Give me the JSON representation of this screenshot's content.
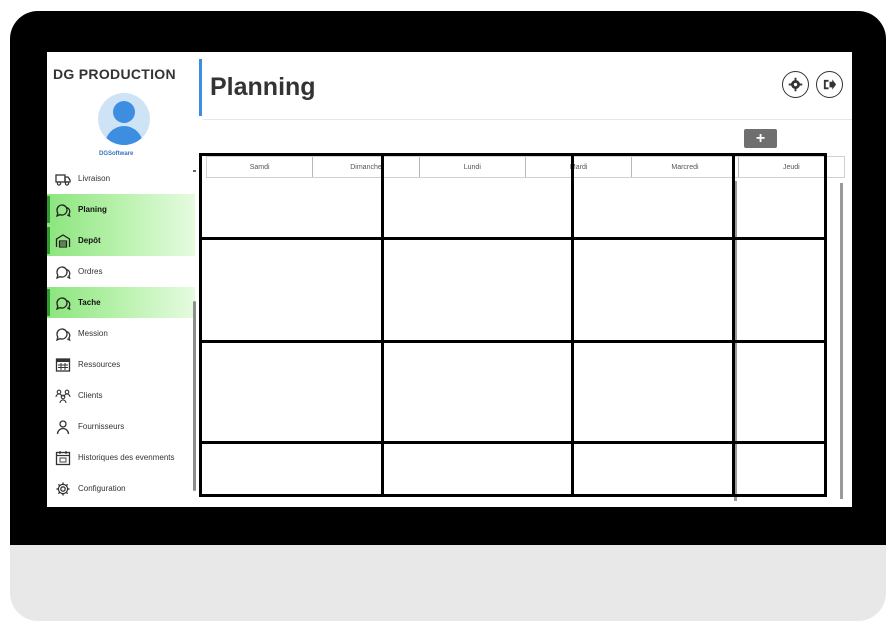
{
  "app": {
    "brand": "DG PRODUCTION",
    "subbrand": "DGSoftware"
  },
  "header": {
    "title": "Planning",
    "settings_icon": "gear-icon",
    "logout_icon": "logout-icon",
    "add_label": "+"
  },
  "sidebar": {
    "items": [
      {
        "label": "Livraison",
        "icon": "truck-icon",
        "active": false
      },
      {
        "label": "Planing",
        "icon": "chat-icon",
        "active": true
      },
      {
        "label": "Depôt",
        "icon": "warehouse-icon",
        "active": true
      },
      {
        "label": "Ordres",
        "icon": "chat-icon",
        "active": false
      },
      {
        "label": "Tache",
        "icon": "chat-icon",
        "active": true
      },
      {
        "label": "Mession",
        "icon": "chat-icon",
        "active": false
      },
      {
        "label": "Ressources",
        "icon": "calendar-grid-icon",
        "active": false
      },
      {
        "label": "Clients",
        "icon": "users-icon",
        "active": false
      },
      {
        "label": "Fournisseurs",
        "icon": "user-icon",
        "active": false
      },
      {
        "label": "Historiques des evenments",
        "icon": "calendar-icon",
        "active": false
      },
      {
        "label": "Configuration",
        "icon": "cog-icon",
        "active": false
      }
    ]
  },
  "planning": {
    "days": [
      "Samdi",
      "Dimanche",
      "Lundi",
      "Mardi",
      "Marcredi",
      "Jeudi"
    ]
  }
}
